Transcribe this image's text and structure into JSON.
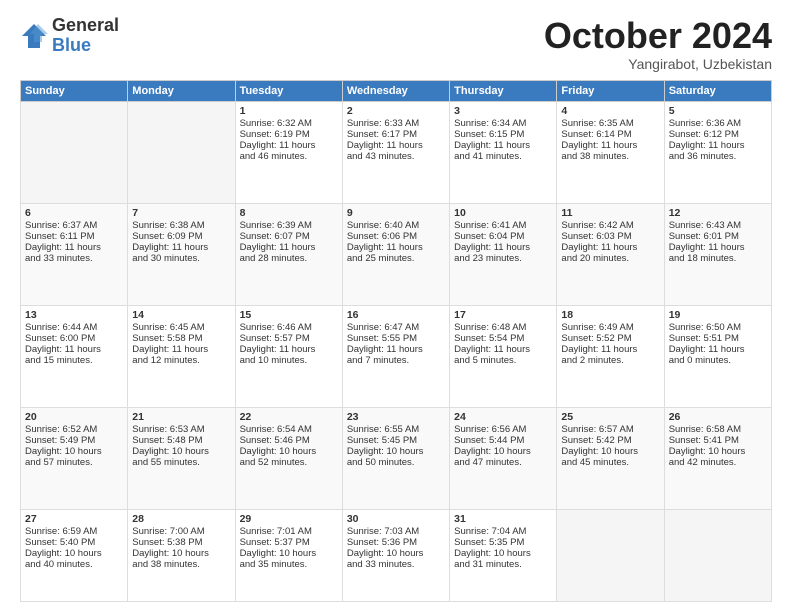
{
  "logo": {
    "general": "General",
    "blue": "Blue"
  },
  "title": "October 2024",
  "location": "Yangirabot, Uzbekistan",
  "days": [
    "Sunday",
    "Monday",
    "Tuesday",
    "Wednesday",
    "Thursday",
    "Friday",
    "Saturday"
  ],
  "weeks": [
    [
      {
        "num": "",
        "lines": []
      },
      {
        "num": "",
        "lines": []
      },
      {
        "num": "1",
        "lines": [
          "Sunrise: 6:32 AM",
          "Sunset: 6:19 PM",
          "Daylight: 11 hours",
          "and 46 minutes."
        ]
      },
      {
        "num": "2",
        "lines": [
          "Sunrise: 6:33 AM",
          "Sunset: 6:17 PM",
          "Daylight: 11 hours",
          "and 43 minutes."
        ]
      },
      {
        "num": "3",
        "lines": [
          "Sunrise: 6:34 AM",
          "Sunset: 6:15 PM",
          "Daylight: 11 hours",
          "and 41 minutes."
        ]
      },
      {
        "num": "4",
        "lines": [
          "Sunrise: 6:35 AM",
          "Sunset: 6:14 PM",
          "Daylight: 11 hours",
          "and 38 minutes."
        ]
      },
      {
        "num": "5",
        "lines": [
          "Sunrise: 6:36 AM",
          "Sunset: 6:12 PM",
          "Daylight: 11 hours",
          "and 36 minutes."
        ]
      }
    ],
    [
      {
        "num": "6",
        "lines": [
          "Sunrise: 6:37 AM",
          "Sunset: 6:11 PM",
          "Daylight: 11 hours",
          "and 33 minutes."
        ]
      },
      {
        "num": "7",
        "lines": [
          "Sunrise: 6:38 AM",
          "Sunset: 6:09 PM",
          "Daylight: 11 hours",
          "and 30 minutes."
        ]
      },
      {
        "num": "8",
        "lines": [
          "Sunrise: 6:39 AM",
          "Sunset: 6:07 PM",
          "Daylight: 11 hours",
          "and 28 minutes."
        ]
      },
      {
        "num": "9",
        "lines": [
          "Sunrise: 6:40 AM",
          "Sunset: 6:06 PM",
          "Daylight: 11 hours",
          "and 25 minutes."
        ]
      },
      {
        "num": "10",
        "lines": [
          "Sunrise: 6:41 AM",
          "Sunset: 6:04 PM",
          "Daylight: 11 hours",
          "and 23 minutes."
        ]
      },
      {
        "num": "11",
        "lines": [
          "Sunrise: 6:42 AM",
          "Sunset: 6:03 PM",
          "Daylight: 11 hours",
          "and 20 minutes."
        ]
      },
      {
        "num": "12",
        "lines": [
          "Sunrise: 6:43 AM",
          "Sunset: 6:01 PM",
          "Daylight: 11 hours",
          "and 18 minutes."
        ]
      }
    ],
    [
      {
        "num": "13",
        "lines": [
          "Sunrise: 6:44 AM",
          "Sunset: 6:00 PM",
          "Daylight: 11 hours",
          "and 15 minutes."
        ]
      },
      {
        "num": "14",
        "lines": [
          "Sunrise: 6:45 AM",
          "Sunset: 5:58 PM",
          "Daylight: 11 hours",
          "and 12 minutes."
        ]
      },
      {
        "num": "15",
        "lines": [
          "Sunrise: 6:46 AM",
          "Sunset: 5:57 PM",
          "Daylight: 11 hours",
          "and 10 minutes."
        ]
      },
      {
        "num": "16",
        "lines": [
          "Sunrise: 6:47 AM",
          "Sunset: 5:55 PM",
          "Daylight: 11 hours",
          "and 7 minutes."
        ]
      },
      {
        "num": "17",
        "lines": [
          "Sunrise: 6:48 AM",
          "Sunset: 5:54 PM",
          "Daylight: 11 hours",
          "and 5 minutes."
        ]
      },
      {
        "num": "18",
        "lines": [
          "Sunrise: 6:49 AM",
          "Sunset: 5:52 PM",
          "Daylight: 11 hours",
          "and 2 minutes."
        ]
      },
      {
        "num": "19",
        "lines": [
          "Sunrise: 6:50 AM",
          "Sunset: 5:51 PM",
          "Daylight: 11 hours",
          "and 0 minutes."
        ]
      }
    ],
    [
      {
        "num": "20",
        "lines": [
          "Sunrise: 6:52 AM",
          "Sunset: 5:49 PM",
          "Daylight: 10 hours",
          "and 57 minutes."
        ]
      },
      {
        "num": "21",
        "lines": [
          "Sunrise: 6:53 AM",
          "Sunset: 5:48 PM",
          "Daylight: 10 hours",
          "and 55 minutes."
        ]
      },
      {
        "num": "22",
        "lines": [
          "Sunrise: 6:54 AM",
          "Sunset: 5:46 PM",
          "Daylight: 10 hours",
          "and 52 minutes."
        ]
      },
      {
        "num": "23",
        "lines": [
          "Sunrise: 6:55 AM",
          "Sunset: 5:45 PM",
          "Daylight: 10 hours",
          "and 50 minutes."
        ]
      },
      {
        "num": "24",
        "lines": [
          "Sunrise: 6:56 AM",
          "Sunset: 5:44 PM",
          "Daylight: 10 hours",
          "and 47 minutes."
        ]
      },
      {
        "num": "25",
        "lines": [
          "Sunrise: 6:57 AM",
          "Sunset: 5:42 PM",
          "Daylight: 10 hours",
          "and 45 minutes."
        ]
      },
      {
        "num": "26",
        "lines": [
          "Sunrise: 6:58 AM",
          "Sunset: 5:41 PM",
          "Daylight: 10 hours",
          "and 42 minutes."
        ]
      }
    ],
    [
      {
        "num": "27",
        "lines": [
          "Sunrise: 6:59 AM",
          "Sunset: 5:40 PM",
          "Daylight: 10 hours",
          "and 40 minutes."
        ]
      },
      {
        "num": "28",
        "lines": [
          "Sunrise: 7:00 AM",
          "Sunset: 5:38 PM",
          "Daylight: 10 hours",
          "and 38 minutes."
        ]
      },
      {
        "num": "29",
        "lines": [
          "Sunrise: 7:01 AM",
          "Sunset: 5:37 PM",
          "Daylight: 10 hours",
          "and 35 minutes."
        ]
      },
      {
        "num": "30",
        "lines": [
          "Sunrise: 7:03 AM",
          "Sunset: 5:36 PM",
          "Daylight: 10 hours",
          "and 33 minutes."
        ]
      },
      {
        "num": "31",
        "lines": [
          "Sunrise: 7:04 AM",
          "Sunset: 5:35 PM",
          "Daylight: 10 hours",
          "and 31 minutes."
        ]
      },
      {
        "num": "",
        "lines": []
      },
      {
        "num": "",
        "lines": []
      }
    ]
  ]
}
